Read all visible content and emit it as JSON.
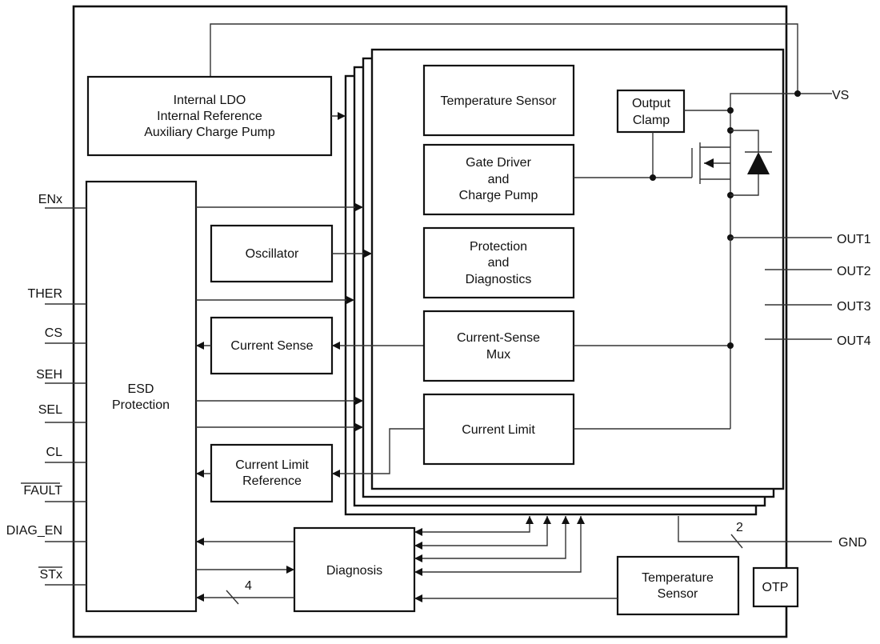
{
  "diagram": {
    "blocks": {
      "ldo": [
        "Internal LDO",
        "Internal Reference",
        "Auxiliary Charge Pump"
      ],
      "esd": [
        "ESD",
        "Protection"
      ],
      "oscillator": [
        "Oscillator"
      ],
      "current_sense": [
        "Current Sense"
      ],
      "current_limit_ref": [
        "Current Limit",
        "Reference"
      ],
      "diagnosis": [
        "Diagnosis"
      ],
      "temp_sensor_main": [
        "Temperature",
        "Sensor"
      ],
      "otp": [
        "OTP"
      ],
      "temp_sensor_ch": [
        "Temperature Sensor"
      ],
      "gate_driver": [
        "Gate Driver",
        "and",
        "Charge Pump"
      ],
      "protection_diag": [
        "Protection",
        "and",
        "Diagnostics"
      ],
      "cs_mux": [
        "Current-Sense",
        "Mux"
      ],
      "current_limit": [
        "Current Limit"
      ],
      "output_clamp": [
        "Output",
        "Clamp"
      ]
    },
    "pins_left": [
      "ENx",
      "THER",
      "CS",
      "SEH",
      "SEL",
      "CL",
      "FAULT",
      "DIAG_EN",
      "STx"
    ],
    "pins_left_overbar": [
      "FAULT",
      "STx"
    ],
    "pins_right": [
      "VS",
      "OUT1",
      "OUT2",
      "OUT3",
      "OUT4",
      "GND"
    ],
    "bus_labels": {
      "diag_bus": "4",
      "gnd_bus": "2"
    },
    "channel_count": 4
  }
}
